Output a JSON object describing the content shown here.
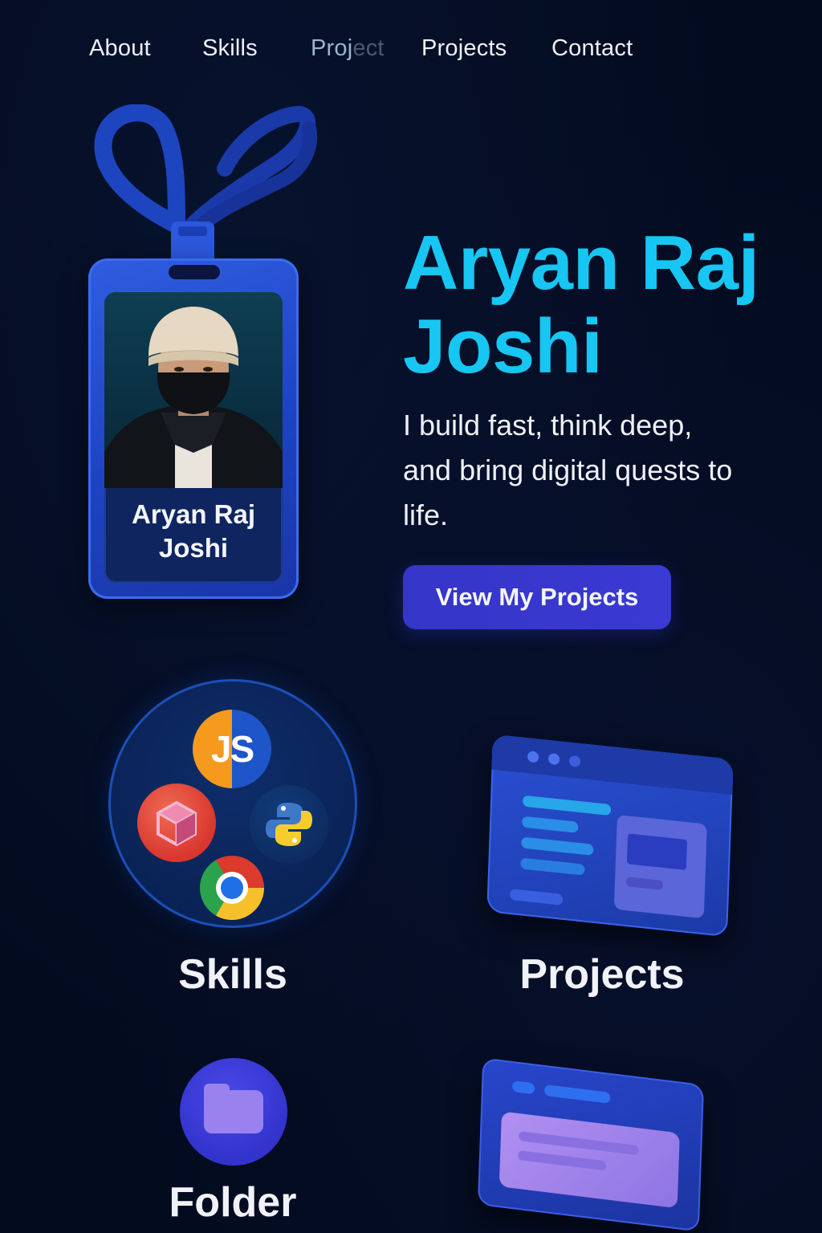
{
  "nav": {
    "items": [
      {
        "label": "About"
      },
      {
        "label": "Skills"
      },
      {
        "label": "Projects"
      },
      {
        "label": "Contact"
      }
    ],
    "ghost_label_visible": "Proj",
    "ghost_label_faded": "ect"
  },
  "badge": {
    "name_line1": "Aryan Raj",
    "name_line2": "Joshi"
  },
  "hero": {
    "title_line1": "Aryan Raj",
    "title_line2": "Joshi",
    "tagline_line1": "I build fast, think deep,",
    "tagline_line2": "and bring digital quests to",
    "tagline_line3": "life.",
    "cta_label": "View My Projects"
  },
  "sections": {
    "skills_label": "Skills",
    "projects_label": "Projects",
    "folder_label": "Folder"
  },
  "skills_icons": [
    "javascript-icon",
    "cube-icon",
    "python-icon",
    "chrome-icon"
  ],
  "colors": {
    "background": "#030b1f",
    "accent_cyan": "#17c6f2",
    "button": "#3535c8",
    "badge_blue": "#2f5de0"
  }
}
